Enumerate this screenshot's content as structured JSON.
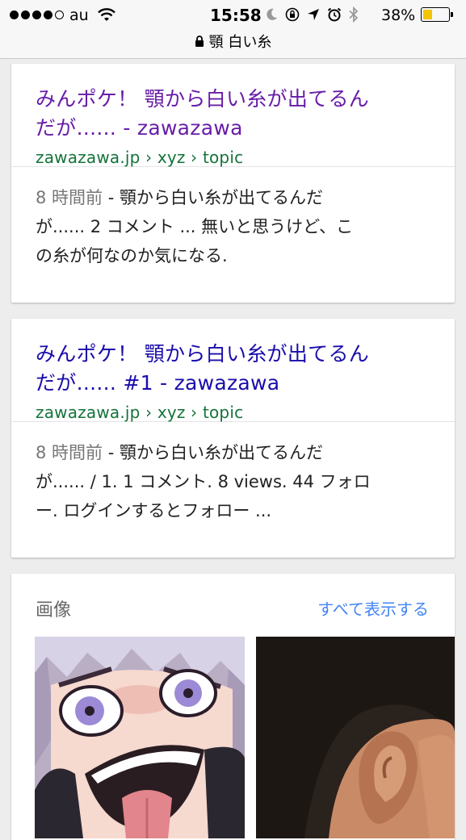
{
  "status_bar": {
    "carrier": "au",
    "time": "15:58",
    "battery_percent": "38%",
    "battery_level": 0.38,
    "signal_bars_filled": 4,
    "signal_bars_total": 5
  },
  "url_bar": {
    "query": "顎 白い糸"
  },
  "results": [
    {
      "title_line1": "みんポケ！ 顎から白い糸が出てるん",
      "title_line2": "だが...... - zawazawa",
      "url": "zawazawa.jp › xyz › topic",
      "age": "8 時間前",
      "snippet_line1": " - 顎から白い糸が出てるんだ",
      "snippet_line2": "が...... 2 コメント ... 無いと思うけど、こ",
      "snippet_line3": "の糸が何なのか気になる.",
      "visited": true
    },
    {
      "title_line1": "みんポケ！ 顎から白い糸が出てるん",
      "title_line2": "だが...... #1 - zawazawa",
      "url": "zawazawa.jp › xyz › topic",
      "age": "8 時間前",
      "snippet_line1": " - 顎から白い糸が出てるんだ",
      "snippet_line2": "が...... / 1. 1 コメント. 8 views. 44 フォロ",
      "snippet_line3": "ー. ログインするとフォロー ...",
      "visited": false
    }
  ],
  "images": {
    "label": "画像",
    "show_all": "すべて表示する",
    "thumbnails": [
      "anime-girl-tongue-thumbnail",
      "ear-closeup-thumbnail"
    ]
  },
  "colors": {
    "visited_link": "#681da8",
    "link": "#1a0dab",
    "url_green": "#14733a",
    "accent_blue": "#4285f4",
    "battery_yellow": "#f3c400"
  }
}
